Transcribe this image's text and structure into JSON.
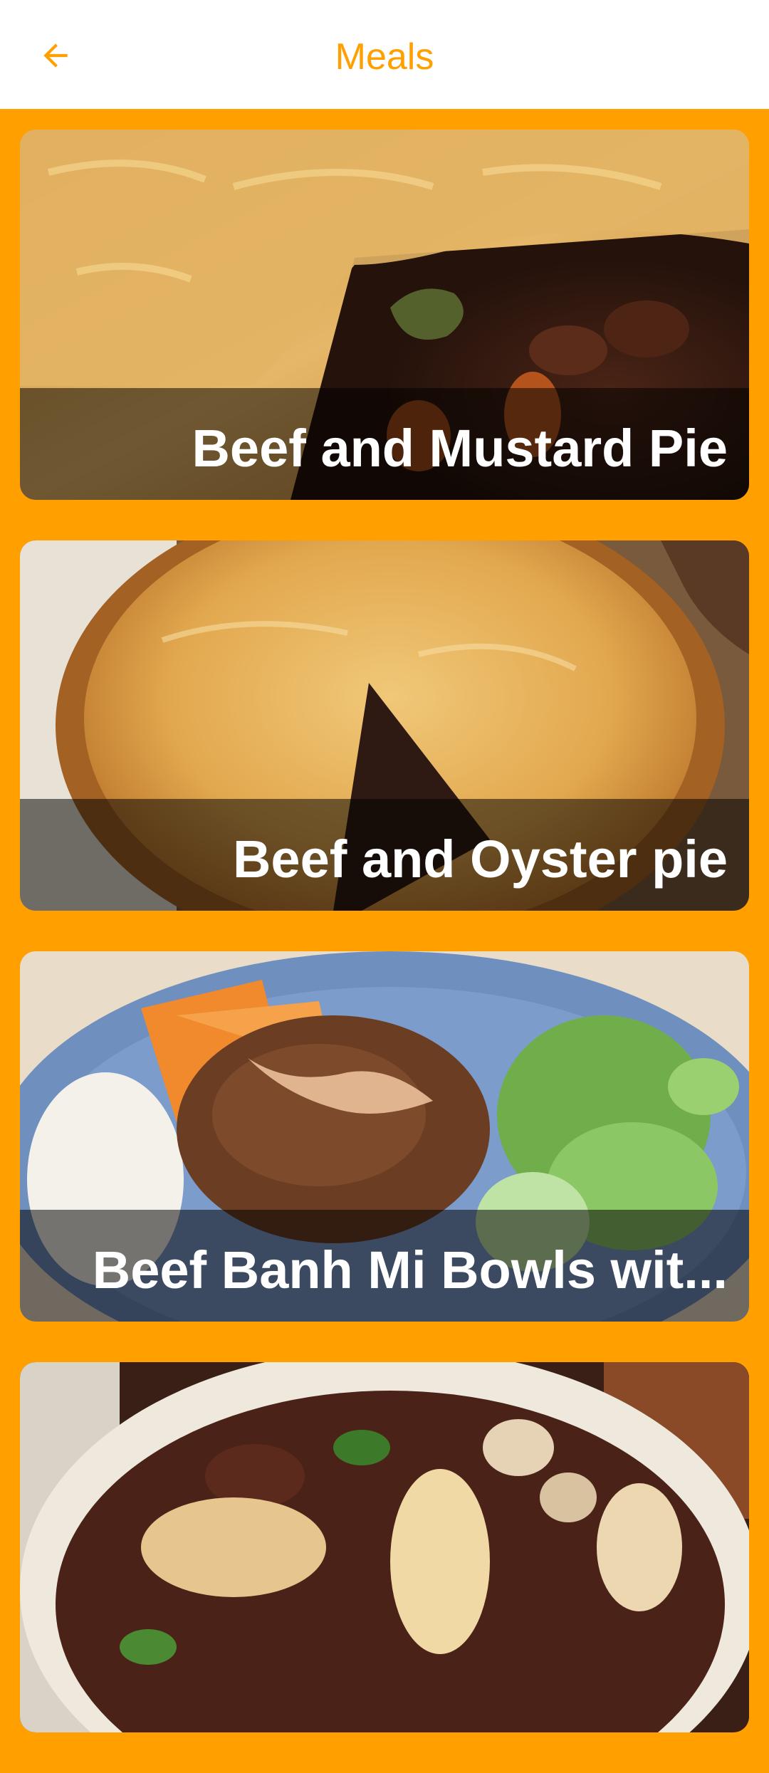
{
  "appbar": {
    "title": "Meals",
    "back_icon": "arrow-back-icon",
    "accent_color": "#FFA000"
  },
  "meals": [
    {
      "name": "Beef and Mustard Pie",
      "image": "meal-photo-beef-mustard-pie"
    },
    {
      "name": "Beef and Oyster pie",
      "image": "meal-photo-beef-oyster-pie"
    },
    {
      "name": "Beef Banh Mi Bowls wit...",
      "image": "meal-photo-beef-banh-mi-bowl"
    },
    {
      "name": "",
      "image": "meal-photo-beef-stew"
    }
  ]
}
